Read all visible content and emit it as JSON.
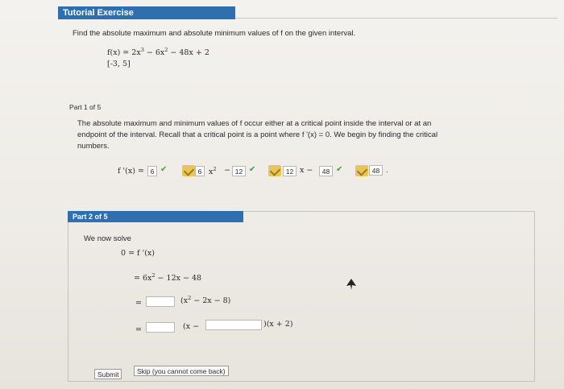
{
  "header": {
    "title": "Tutorial Exercise"
  },
  "problem": {
    "prompt": "Find the absolute maximum and absolute minimum values of f on the given interval.",
    "function_lhs": "f(x) = 2x",
    "exp3": "3",
    "function_mid": " − 6x",
    "exp2": "2",
    "function_rhs": " − 48x + 2",
    "interval": "[-3, 5]"
  },
  "part1": {
    "label": "Part 1 of 5",
    "line1": "The absolute maximum and minimum values of f occur either at a critical point inside the interval or at an",
    "line2": "endpoint of the interval. Recall that a critical point is a point where f '(x) = 0. We begin by finding the critical",
    "line3": "numbers.",
    "deriv_lhs": "f '(x) =",
    "ans1": "6",
    "ans2": "6",
    "x2": "x",
    "sq": "2",
    "minus1": "−",
    "ans3": "12",
    "ans4": "12",
    "xminus": "x −",
    "ans5": "48",
    "ans6": "48",
    "dot": "."
  },
  "part2": {
    "label": "Part 2 of 5",
    "intro": "We now solve",
    "eq0": "0 = f '(x)",
    "eq1": "= 6x",
    "eq1_exp": "2",
    "eq1_rest": " − 12x − 48",
    "eq2_eq": "=",
    "eq2_rest": "(x",
    "eq2_exp": "2",
    "eq2_tail": " − 2x − 8)",
    "eq3_eq": "=",
    "eq3_mid": "(x −",
    "eq3_tail": ")(x + 2)",
    "submit_label": "Submit",
    "skip_label": "Skip (you cannot come back)"
  }
}
